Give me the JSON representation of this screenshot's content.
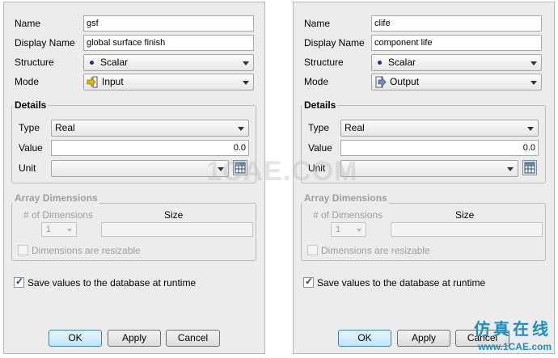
{
  "labels": {
    "name": "Name",
    "display_name": "Display Name",
    "structure": "Structure",
    "mode": "Mode",
    "details": "Details",
    "type": "Type",
    "value": "Value",
    "unit": "Unit",
    "array_dimensions": "Array Dimensions",
    "num_dimensions": "# of Dimensions",
    "size": "Size",
    "dimensions_resizable": "Dimensions are resizable",
    "save_values": "Save values to the database at runtime"
  },
  "buttons": {
    "ok": "OK",
    "apply": "Apply",
    "cancel": "Cancel"
  },
  "dialogs": [
    {
      "name": "gsf",
      "display_name": "global surface finish",
      "structure": "Scalar",
      "mode": "Input",
      "type": "Real",
      "value": "0.0",
      "unit": "",
      "num_dimensions": "1",
      "dimensions_resizable": false,
      "save_values": true
    },
    {
      "name": "clife",
      "display_name": "component life",
      "structure": "Scalar",
      "mode": "Output",
      "type": "Real",
      "value": "0.0",
      "unit": "",
      "num_dimensions": "1",
      "dimensions_resizable": false,
      "save_values": true
    }
  ],
  "watermarks": {
    "center": "1CAE.COM",
    "brand_cn": "仿真在线",
    "brand_url": "www.1CAE.com"
  },
  "colors": {
    "brand": "#1d8fbf",
    "primary_button": "#bee6fd"
  }
}
